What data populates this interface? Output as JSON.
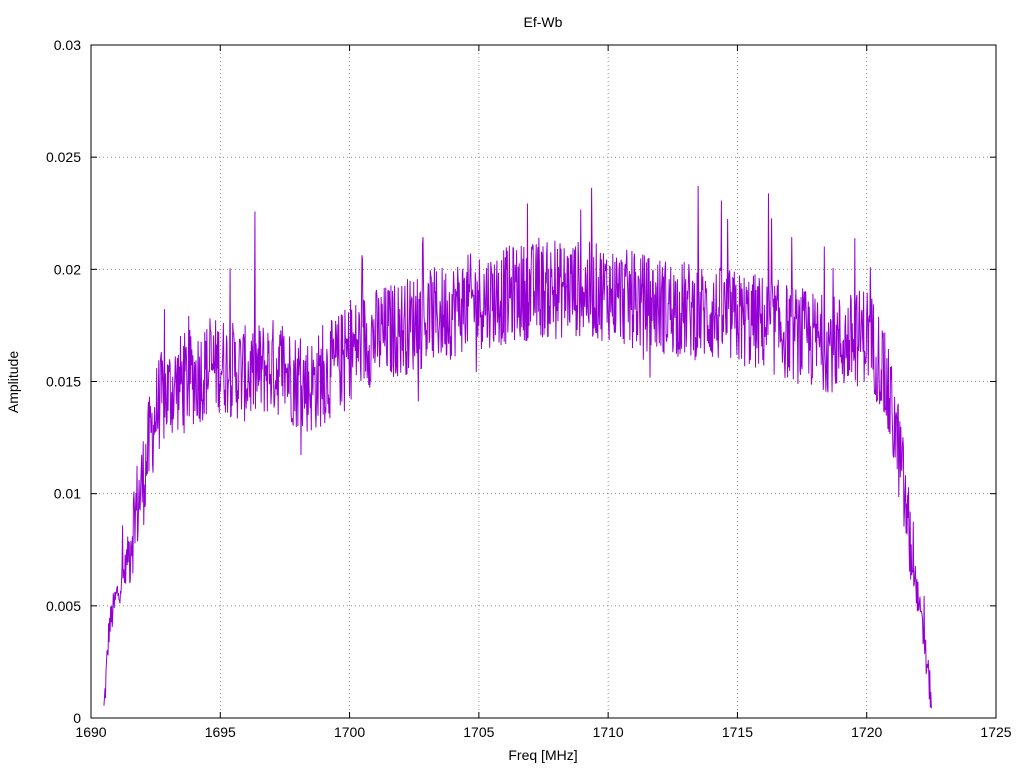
{
  "chart_data": {
    "type": "line",
    "title": "Ef-Wb",
    "xlabel": "Freq [MHz]",
    "ylabel": "Amplitude",
    "xlim": [
      1690,
      1725
    ],
    "ylim": [
      0,
      0.03
    ],
    "xticks": [
      1690,
      1695,
      1700,
      1705,
      1710,
      1715,
      1720,
      1725
    ],
    "yticks": [
      0,
      0.005,
      0.01,
      0.015,
      0.02,
      0.025,
      0.03
    ],
    "ytick_labels": [
      "0",
      "0.005",
      "0.01",
      "0.015",
      "0.02",
      "0.025",
      "0.03"
    ],
    "grid": true,
    "line_color": "#9400d3",
    "series": [
      {
        "x": [
          1690.5,
          1690.7,
          1691.0,
          1691.3,
          1691.6,
          1692.0,
          1692.3,
          1692.6,
          1693.0,
          1693.5,
          1694.0,
          1694.5,
          1695.0,
          1695.5,
          1696.0,
          1696.5,
          1697.0,
          1697.5,
          1698.0,
          1698.5,
          1699.0,
          1699.5,
          1700.0,
          1700.5,
          1701.0,
          1701.5,
          1702.0,
          1702.5,
          1703.0,
          1703.5,
          1704.0,
          1704.5,
          1705.0,
          1705.5,
          1706.0,
          1706.5,
          1707.0,
          1707.5,
          1708.0,
          1708.5,
          1709.0,
          1709.5,
          1710.0,
          1710.5,
          1711.0,
          1711.5,
          1712.0,
          1712.5,
          1713.0,
          1713.5,
          1714.0,
          1714.5,
          1715.0,
          1715.5,
          1716.0,
          1716.5,
          1717.0,
          1717.5,
          1718.0,
          1718.5,
          1719.0,
          1719.5,
          1720.0,
          1720.5,
          1721.0,
          1721.3,
          1721.6,
          1721.9,
          1722.2,
          1722.5
        ],
        "y": [
          0.0003,
          0.004,
          0.0055,
          0.0065,
          0.0085,
          0.0105,
          0.0125,
          0.014,
          0.0145,
          0.015,
          0.0152,
          0.0155,
          0.0158,
          0.0155,
          0.0153,
          0.0155,
          0.0157,
          0.0155,
          0.015,
          0.0148,
          0.0152,
          0.0158,
          0.0163,
          0.0168,
          0.017,
          0.0172,
          0.0174,
          0.0176,
          0.0178,
          0.018,
          0.0182,
          0.0185,
          0.0186,
          0.0187,
          0.0188,
          0.019,
          0.019,
          0.0191,
          0.019,
          0.0192,
          0.0191,
          0.019,
          0.019,
          0.0188,
          0.0186,
          0.0185,
          0.0184,
          0.0183,
          0.0182,
          0.0181,
          0.018,
          0.0179,
          0.0178,
          0.0177,
          0.0176,
          0.0174,
          0.0172,
          0.017,
          0.0168,
          0.0167,
          0.0167,
          0.0168,
          0.0172,
          0.016,
          0.0135,
          0.0115,
          0.0085,
          0.006,
          0.0035,
          0.0008
        ]
      }
    ]
  }
}
